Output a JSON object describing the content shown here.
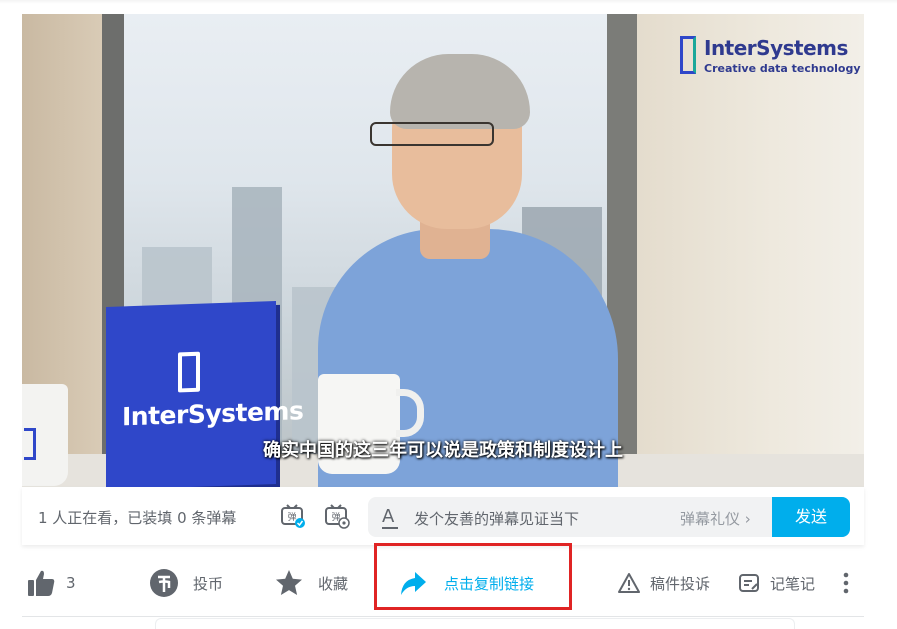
{
  "video": {
    "subtitle": "确实中国的这三年可以说是政策和制度设计上",
    "brand_name": "InterSystems",
    "brand_tagline": "Creative data technology",
    "stand_logo_text": "InterSystems"
  },
  "danmaku_bar": {
    "viewer_status": "1 人正在看，已装填 0 条弹幕",
    "input_placeholder": "发个友善的弹幕见证当下",
    "etiquette_link": "弹幕礼仪 ›",
    "send_label": "发送",
    "accent_color": "#00aeec"
  },
  "toolbar": {
    "like_count": "3",
    "coin_label": "投币",
    "favorite_label": "收藏",
    "share_label": "点击复制链接",
    "report_label": "稿件投诉",
    "notes_label": "记笔记"
  },
  "icons": [
    "like-icon",
    "coin-icon",
    "star-icon",
    "share-arrow-icon",
    "warning-icon",
    "note-icon",
    "more-icon",
    "danmaku-toggle-icon",
    "danmaku-settings-icon",
    "text-style-icon"
  ]
}
